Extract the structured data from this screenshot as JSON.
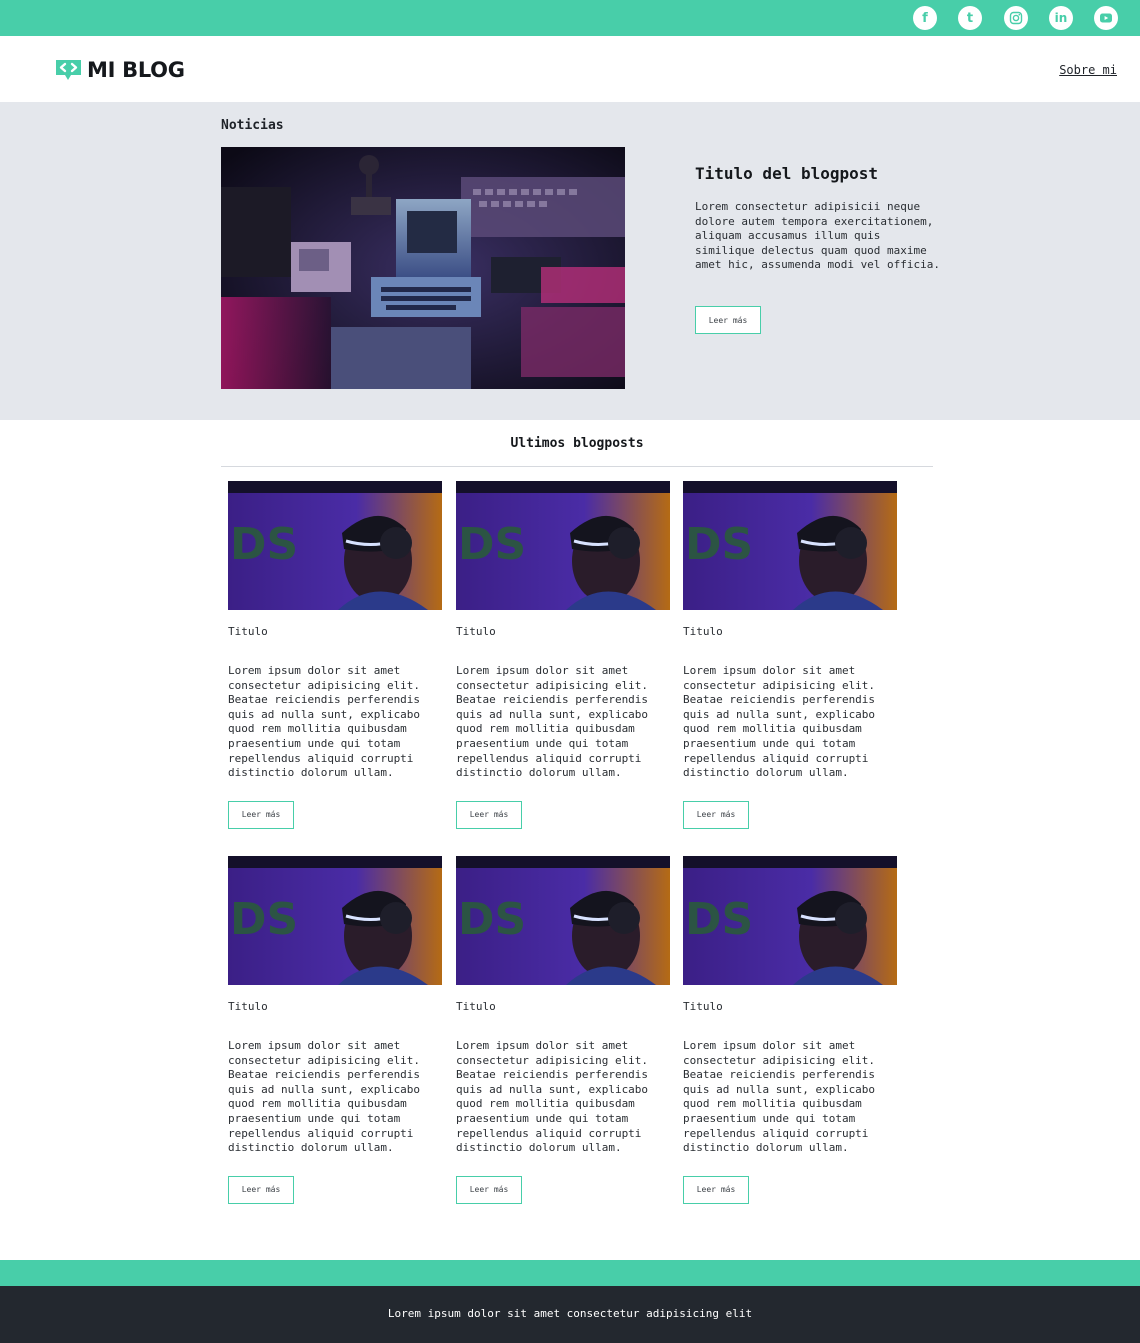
{
  "social": [
    {
      "icon": "facebook-icon",
      "glyph": "f"
    },
    {
      "icon": "tumblr-icon",
      "glyph": "t"
    },
    {
      "icon": "instagram-icon",
      "glyph": ""
    },
    {
      "icon": "linkedin-icon",
      "glyph": "in"
    },
    {
      "icon": "youtube-icon",
      "glyph": ""
    }
  ],
  "header": {
    "logo_text": "MI BLOG",
    "nav_link": "Sobre mi"
  },
  "news": {
    "label": "Noticias",
    "image_icon": "retro-computers-photo",
    "title": "Titulo del blogpost",
    "text": "Lorem consectetur adipisicii neque dolore autem tempora exercitationem, aliquam accusamus illum quis similique delectus quam quod maxime amet hic, assumenda modi vel officia.",
    "button": "Leer más"
  },
  "latest": {
    "title": "Ultimos blogposts",
    "cards": [
      {
        "title": "Titulo",
        "text": "Lorem ipsum dolor sit amet consectetur adipisicing elit. Beatae reiciendis perferendis quis ad nulla sunt, explicabo quod rem mollitia quibusdam praesentium unde qui totam repellendus aliquid corrupti distinctio dolorum ullam.",
        "button": "Leer más"
      },
      {
        "title": "Titulo",
        "text": "Lorem ipsum dolor sit amet consectetur adipisicing elit. Beatae reiciendis perferendis quis ad nulla sunt, explicabo quod rem mollitia quibusdam praesentium unde qui totam repellendus aliquid corrupti distinctio dolorum ullam.",
        "button": "Leer más"
      },
      {
        "title": "Titulo",
        "text": "Lorem ipsum dolor sit amet consectetur adipisicing elit. Beatae reiciendis perferendis quis ad nulla sunt, explicabo quod rem mollitia quibusdam praesentium unde qui totam repellendus aliquid corrupti distinctio dolorum ullam.",
        "button": "Leer más"
      },
      {
        "title": "Titulo",
        "text": "Lorem ipsum dolor sit amet consectetur adipisicing elit. Beatae reiciendis perferendis quis ad nulla sunt, explicabo quod rem mollitia quibusdam praesentium unde qui totam repellendus aliquid corrupti distinctio dolorum ullam.",
        "button": "Leer más"
      },
      {
        "title": "Titulo",
        "text": "Lorem ipsum dolor sit amet consectetur adipisicing elit. Beatae reiciendis perferendis quis ad nulla sunt, explicabo quod rem mollitia quibusdam praesentium unde qui totam repellendus aliquid corrupti distinctio dolorum ullam.",
        "button": "Leer más"
      },
      {
        "title": "Titulo",
        "text": "Lorem ipsum dolor sit amet consectetur adipisicing elit. Beatae reiciendis perferendis quis ad nulla sunt, explicabo quod rem mollitia quibusdam praesentium unde qui totam repellendus aliquid corrupti distinctio dolorum ullam.",
        "button": "Leer más"
      }
    ]
  },
  "footer": {
    "text": "Lorem ipsum dolor sit amet consectetur adipisicing elit"
  },
  "colors": {
    "accent": "#48cea9",
    "news_bg": "#e4e7ec",
    "footer_bg": "#23282f"
  }
}
